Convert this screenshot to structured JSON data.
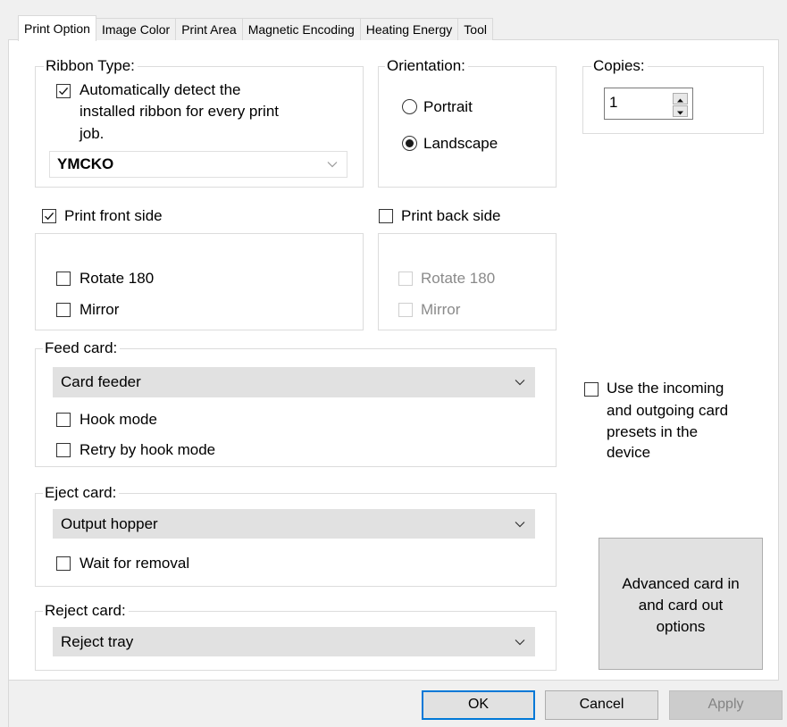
{
  "tabs": [
    "Print Option",
    "Image Color",
    "Print Area",
    "Magnetic Encoding",
    "Heating Energy",
    "Tool"
  ],
  "ribbon": {
    "legend": "Ribbon Type:",
    "auto_detect_line1": "Automatically detect the",
    "auto_detect_line2": "installed ribbon for every print",
    "auto_detect_line3": "job.",
    "auto_detect_checked": true,
    "selected": "YMCKO"
  },
  "orientation": {
    "legend": "Orientation:",
    "portrait": "Portrait",
    "landscape": "Landscape",
    "selected": "Landscape"
  },
  "copies": {
    "legend": "Copies:",
    "value": "1"
  },
  "front": {
    "label": "Print front side",
    "checked": true,
    "rotate": "Rotate 180",
    "mirror": "Mirror"
  },
  "back": {
    "label": "Print back side",
    "checked": false,
    "rotate": "Rotate 180",
    "mirror": "Mirror"
  },
  "feed": {
    "legend": "Feed card:",
    "selected": "Card feeder",
    "hook": "Hook mode",
    "retry": "Retry by hook mode"
  },
  "eject": {
    "legend": "Eject card:",
    "selected": "Output hopper",
    "wait": "Wait for removal"
  },
  "reject": {
    "legend": "Reject card:",
    "selected": "Reject tray"
  },
  "presets": {
    "line1": "Use the incoming",
    "line2": "and outgoing card",
    "line3": "presets in the",
    "line4": "device"
  },
  "advanced": {
    "line1": "Advanced card in",
    "line2": "and card out",
    "line3": "options"
  },
  "buttons": {
    "ok": "OK",
    "cancel": "Cancel",
    "apply": "Apply"
  },
  "colors": {
    "focus_border": "#0078d7",
    "button_face": "#e1e1e1",
    "combo_grey": "#e1e1e1"
  }
}
